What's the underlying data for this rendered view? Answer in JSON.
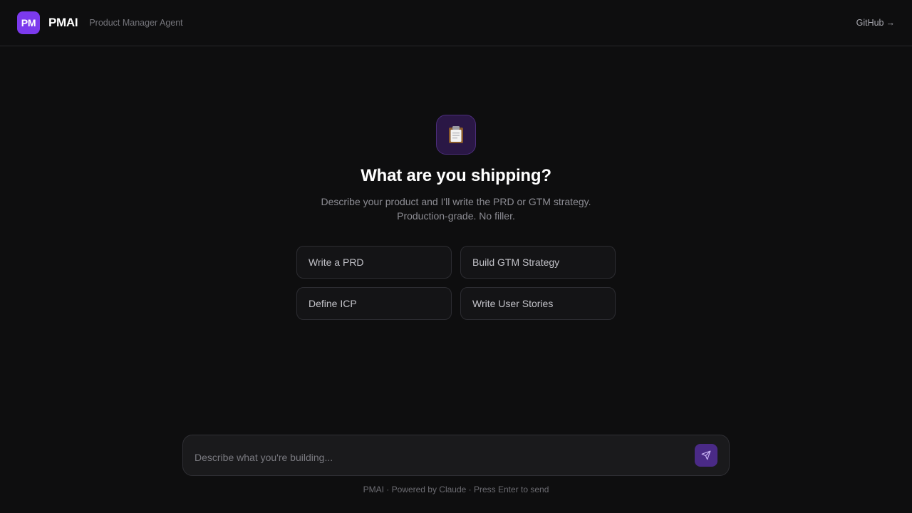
{
  "header": {
    "logo_text": "PM",
    "brand_name": "PMAI",
    "tagline": "Product Manager Agent",
    "github_label": "GitHub",
    "github_arrow": "→"
  },
  "hero": {
    "icon": "clipboard-icon",
    "title": "What are you shipping?",
    "subtitle_line1": "Describe your product and I'll write the PRD or GTM strategy.",
    "subtitle_line2": "Production-grade. No filler."
  },
  "suggestions": [
    {
      "label": "Write a PRD"
    },
    {
      "label": "Build GTM Strategy"
    },
    {
      "label": "Define ICP"
    },
    {
      "label": "Write User Stories"
    }
  ],
  "composer": {
    "placeholder": "Describe what you're building...",
    "value": "",
    "send_icon": "send-icon"
  },
  "footer": {
    "note": "PMAI · Powered by Claude · Press Enter to send"
  },
  "colors": {
    "accent": "#7c3aed",
    "background": "#0e0e0f"
  }
}
